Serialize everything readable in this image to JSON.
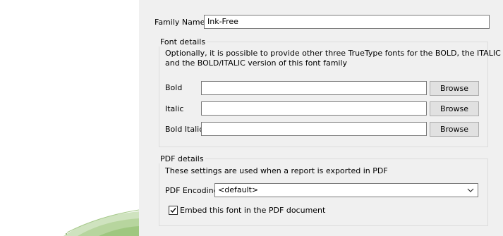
{
  "family": {
    "label": "Family Name",
    "value": "Ink-Free"
  },
  "font_details": {
    "legend": "Font details",
    "description_line1": "Optionally, it is possible to provide other three TrueType fonts for the BOLD, the ITALIC",
    "description_line2": "and the BOLD/ITALIC version of this font family",
    "rows": [
      {
        "label": "Bold",
        "value": "",
        "button": "Browse"
      },
      {
        "label": "Italic",
        "value": "",
        "button": "Browse"
      },
      {
        "label": "Bold Italic",
        "value": "",
        "button": "Browse"
      }
    ]
  },
  "pdf_details": {
    "legend": "PDF details",
    "description": "These settings are used when a report is exported in PDF",
    "encoding_label": "PDF Encoding",
    "encoding_value": "<default>",
    "embed_label": "Embed this font in the PDF document",
    "embed_checked": true
  },
  "colors": {
    "accent_green": "#a6c98a",
    "background": "#f0f0f0"
  },
  "icons": {
    "dropdown": "chevron-down-icon",
    "checkbox": "checkmark-icon"
  }
}
